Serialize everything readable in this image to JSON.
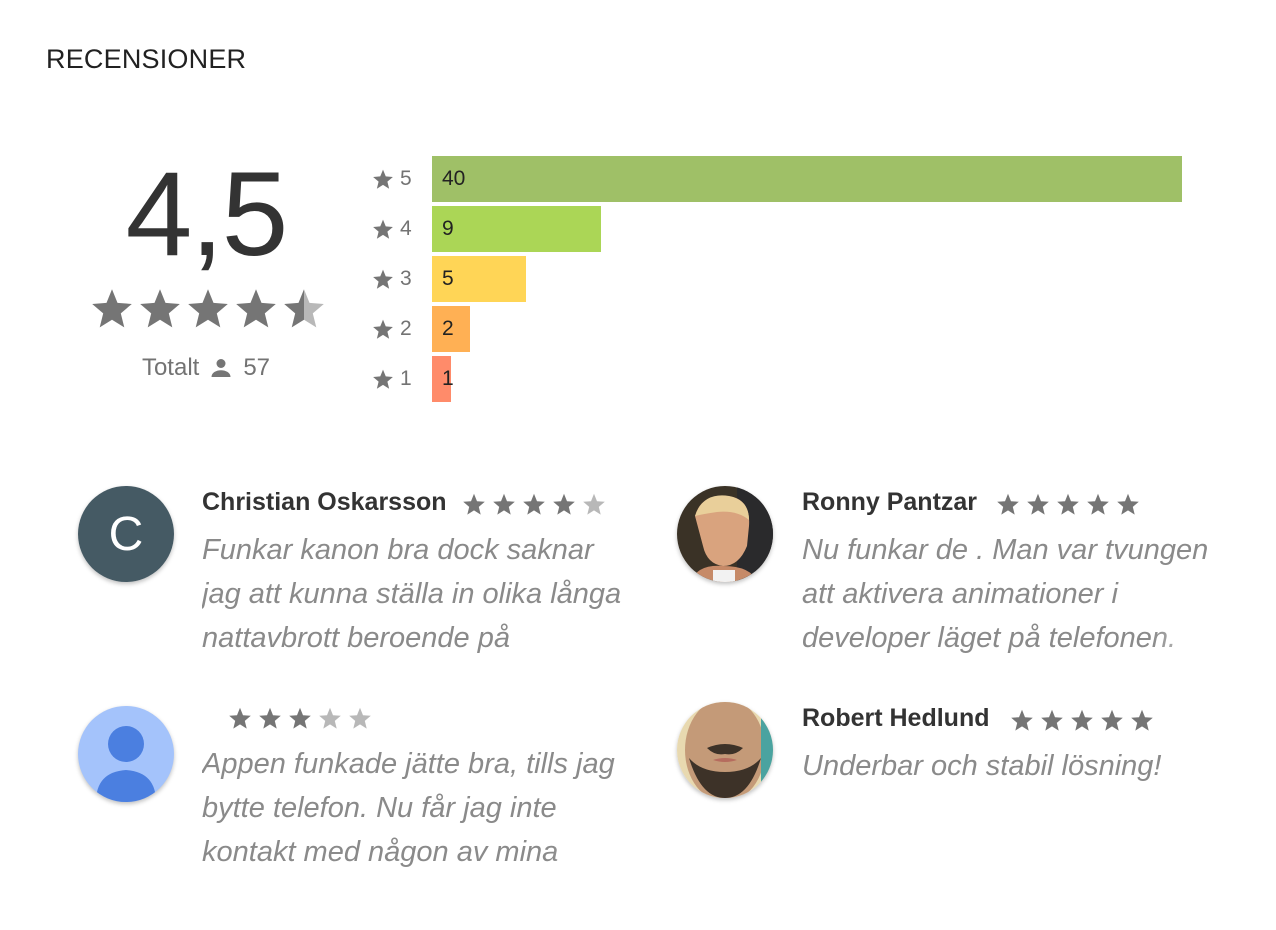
{
  "section": {
    "title": "RECENSIONER"
  },
  "summary": {
    "score": "4,5",
    "score_value": 4.5,
    "total_label": "Totalt",
    "total_count": "57"
  },
  "histogram": [
    {
      "stars": "5",
      "count": "40",
      "value": 40,
      "color": "#9fc067"
    },
    {
      "stars": "4",
      "count": "9",
      "value": 9,
      "color": "#abd656"
    },
    {
      "stars": "3",
      "count": "5",
      "value": 5,
      "color": "#ffd556"
    },
    {
      "stars": "2",
      "count": "2",
      "value": 2,
      "color": "#ffb054"
    },
    {
      "stars": "1",
      "count": "1",
      "value": 1,
      "color": "#ff8b6a"
    }
  ],
  "reviews": [
    {
      "name": "Christian Oskarsson",
      "rating": 4,
      "avatar": {
        "type": "letter",
        "letter": "C",
        "color": "#455a64"
      },
      "text": "Funkar kanon bra dock saknar jag att kunna ställa in olika långa nattavbrott beroende på"
    },
    {
      "name": "Ronny Pantzar",
      "rating": 5,
      "avatar": {
        "type": "photo",
        "icon": "person-photo-icon"
      },
      "text": "Nu funkar de . Man var tvungen att aktivera animationer i developer läget på telefonen."
    },
    {
      "name": "",
      "rating": 3,
      "avatar": {
        "type": "default",
        "icon": "default-user-icon",
        "color": "#a4c3fb"
      },
      "text": "Appen funkade jätte bra, tills jag bytte telefon. Nu får jag inte kontakt med någon av mina"
    },
    {
      "name": "Robert Hedlund",
      "rating": 5,
      "avatar": {
        "type": "photo",
        "icon": "person-photo-icon"
      },
      "text": "Underbar och stabil lösning!"
    }
  ],
  "colors": {
    "star_filled": "#757575",
    "star_empty": "#b8b8b8"
  }
}
